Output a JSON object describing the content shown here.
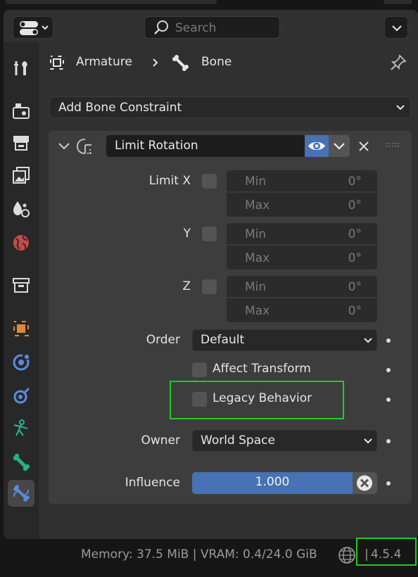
{
  "header": {
    "search_placeholder": "Search",
    "icons": [
      "editor-type-icon",
      "search-icon",
      "chevron-down-icon"
    ]
  },
  "sidebar": {
    "tabs": [
      {
        "name": "tool",
        "icon": "tool-icon"
      },
      {
        "name": "render",
        "icon": "render-icon"
      },
      {
        "name": "output",
        "icon": "output-icon"
      },
      {
        "name": "view-layer",
        "icon": "view-layer-icon"
      },
      {
        "name": "scene",
        "icon": "scene-icon"
      },
      {
        "name": "world",
        "icon": "world-icon"
      },
      {
        "name": "collection",
        "icon": "collection-icon"
      },
      {
        "name": "object",
        "icon": "object-icon"
      },
      {
        "name": "modifiers",
        "icon": "modifiers-icon"
      },
      {
        "name": "physics",
        "icon": "physics-icon"
      },
      {
        "name": "object-data",
        "icon": "armature-data-icon"
      },
      {
        "name": "bone",
        "icon": "bone-icon"
      },
      {
        "name": "bone-constraints",
        "icon": "bone-constraint-icon",
        "active": true
      }
    ]
  },
  "breadcrumb": {
    "object": "Armature",
    "bone": "Bone"
  },
  "add_constraint_label": "Add Bone Constraint",
  "constraint": {
    "name": "Limit Rotation",
    "limit_x_label": "Limit X",
    "y_label": "Y",
    "z_label": "Z",
    "min_label": "Min",
    "max_label": "Max",
    "x_min": "0°",
    "x_max": "0°",
    "y_min": "0°",
    "y_max": "0°",
    "z_min": "0°",
    "z_max": "0°",
    "order_label": "Order",
    "order_value": "Default",
    "affect_transform_label": "Affect Transform",
    "legacy_behavior_label": "Legacy Behavior",
    "owner_label": "Owner",
    "owner_value": "World Space",
    "influence_label": "Influence",
    "influence_value": "1.000",
    "influence_fraction": 1.0
  },
  "colors": {
    "accent_blue": "#4772b3",
    "highlight_green": "#22cc22",
    "panel_bg": "#3d3d3d"
  },
  "status": {
    "memory": "Memory: 37.5 MiB | VRAM: 0.4/24.0 GiB",
    "separator": "|",
    "version": "4.5.4"
  }
}
